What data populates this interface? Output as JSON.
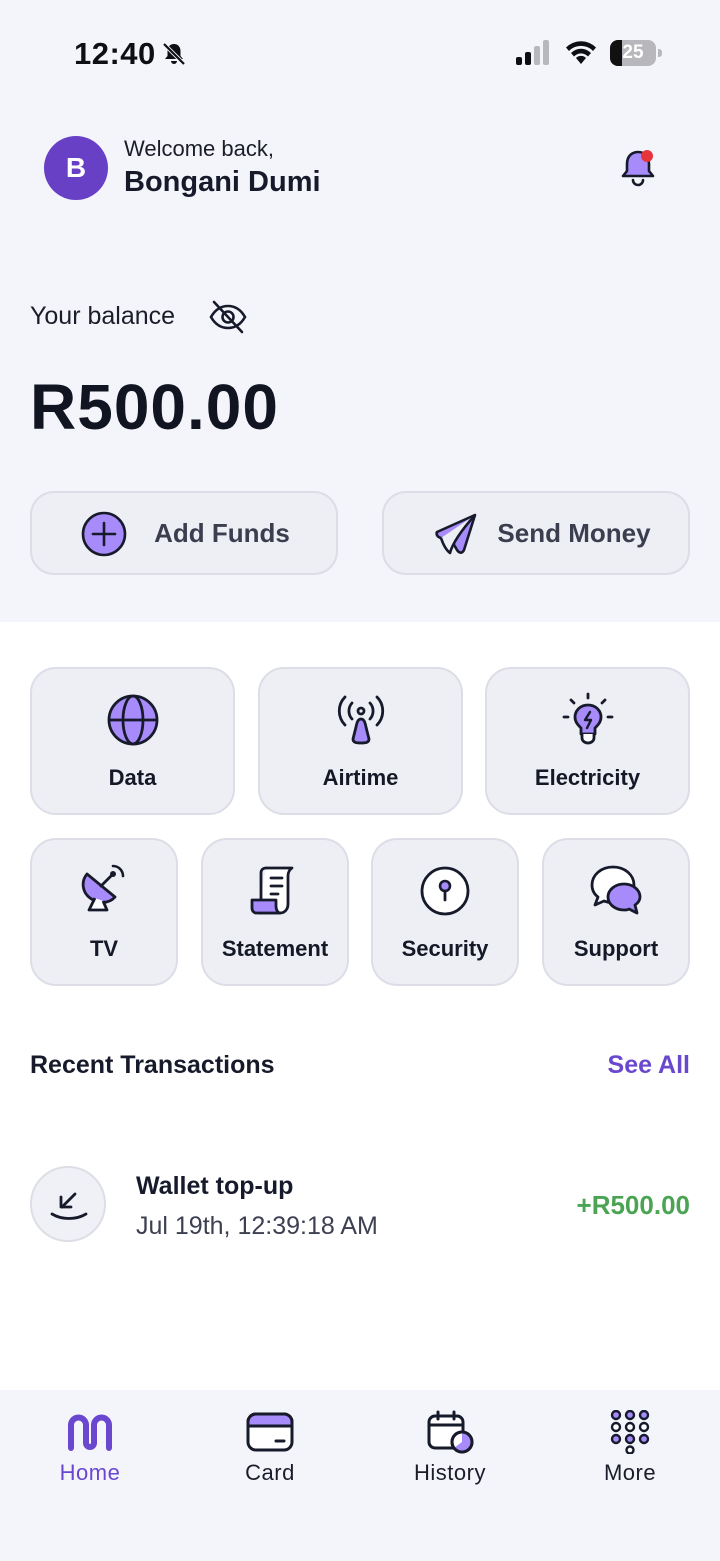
{
  "status_bar": {
    "time": "12:40",
    "battery": "25"
  },
  "header": {
    "avatar_initial": "B",
    "welcome": "Welcome back,",
    "username": "Bongani Dumi"
  },
  "balance": {
    "label": "Your balance",
    "amount": "R500.00"
  },
  "actions": {
    "add_funds": "Add Funds",
    "send_money": "Send Money"
  },
  "services": [
    {
      "label": "Data",
      "icon": "globe-icon"
    },
    {
      "label": "Airtime",
      "icon": "antenna-icon"
    },
    {
      "label": "Electricity",
      "icon": "lightbulb-icon"
    },
    {
      "label": "TV",
      "icon": "satellite-dish-icon"
    },
    {
      "label": "Statement",
      "icon": "receipt-scroll-icon"
    },
    {
      "label": "Security",
      "icon": "keyhole-icon"
    },
    {
      "label": "Support",
      "icon": "chat-bubbles-icon"
    }
  ],
  "recent": {
    "title": "Recent Transactions",
    "see_all": "See All",
    "items": [
      {
        "title": "Wallet top-up",
        "date": "Jul 19th, 12:39:18 AM",
        "amount": "+R500.00",
        "icon": "arrow-down-left-icon"
      }
    ]
  },
  "tabs": [
    {
      "label": "Home",
      "icon": "home-logo-icon",
      "active": true
    },
    {
      "label": "Card",
      "icon": "card-icon",
      "active": false
    },
    {
      "label": "History",
      "icon": "calendar-clock-icon",
      "active": false
    },
    {
      "label": "More",
      "icon": "grid-dots-icon",
      "active": false
    }
  ],
  "colors": {
    "accent": "#6a47cf",
    "avatar": "#6840c6",
    "icon_fill": "#a78bfa",
    "positive": "#4aa454",
    "notification_dot": "#e5343c"
  }
}
